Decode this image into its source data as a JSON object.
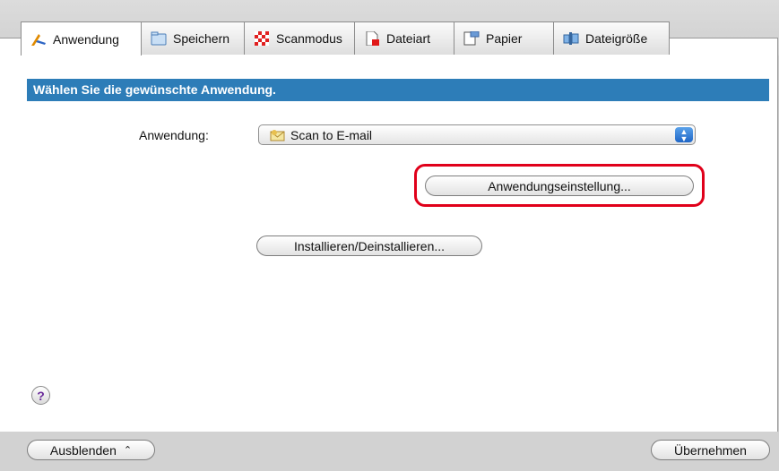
{
  "tabs": [
    {
      "label": "Anwendung",
      "icon": "app-pen-icon",
      "active": true
    },
    {
      "label": "Speichern",
      "icon": "folder-icon"
    },
    {
      "label": "Scanmodus",
      "icon": "checker-icon"
    },
    {
      "label": "Dateiart",
      "icon": "document-icon"
    },
    {
      "label": "Papier",
      "icon": "paper-icon"
    },
    {
      "label": "Dateigröße",
      "icon": "filesize-icon"
    }
  ],
  "header": {
    "title": "Wählen Sie die gewünschte Anwendung."
  },
  "application": {
    "label": "Anwendung:",
    "selected": "Scan to E-mail",
    "selected_icon": "email-app-icon"
  },
  "buttons": {
    "settings": "Anwendungseinstellung...",
    "install": "Installieren/Deinstallieren...",
    "hide": "Ausblenden",
    "apply": "Übernehmen",
    "help": "?"
  },
  "colors": {
    "header_bg": "#2d7db8",
    "highlight": "#e0001a",
    "select_arrow": "#1f66c7"
  }
}
